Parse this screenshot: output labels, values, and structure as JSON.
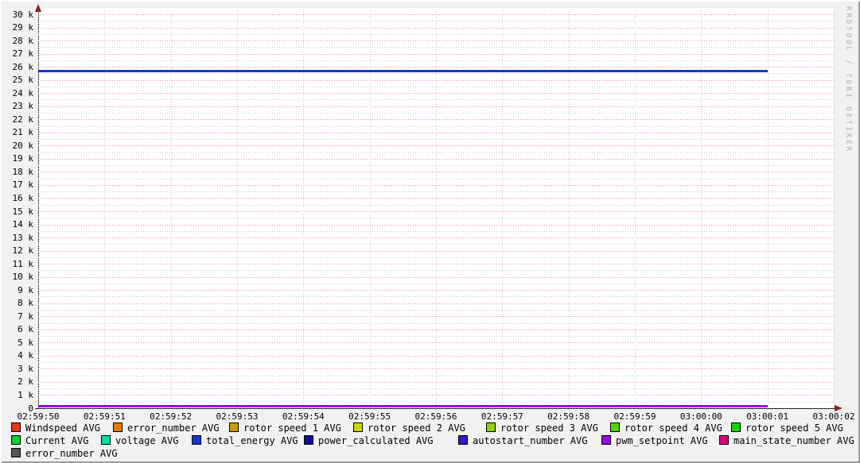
{
  "watermark": "RRDTOOL / TOBI OETIKER",
  "chart_data": {
    "type": "line",
    "title": "",
    "xlabel": "",
    "ylabel": "",
    "ylim": [
      0,
      30000
    ],
    "y_major_step": 1000,
    "y_minor_step": 500,
    "grid": true,
    "y_tick_labels": [
      "0",
      "1 k",
      "2 k",
      "3 k",
      "4 k",
      "5 k",
      "6 k",
      "7 k",
      "8 k",
      "9 k",
      "10 k",
      "11 k",
      "12 k",
      "13 k",
      "14 k",
      "15 k",
      "16 k",
      "17 k",
      "18 k",
      "19 k",
      "20 k",
      "21 k",
      "22 k",
      "23 k",
      "24 k",
      "25 k",
      "26 k",
      "27 k",
      "28 k",
      "29 k",
      "30 k"
    ],
    "x_tick_labels": [
      "02:59:50",
      "02:59:51",
      "02:59:52",
      "02:59:53",
      "02:59:54",
      "02:59:55",
      "02:59:56",
      "02:59:57",
      "02:59:58",
      "02:59:59",
      "03:00:00",
      "03:00:01",
      "03:00:02"
    ],
    "visible_lines": [
      {
        "name": "total_energy AVG",
        "color": "#1038d8",
        "value": 25700,
        "x_start": "02:59:50",
        "x_end": "03:00:01"
      },
      {
        "name": "pwm_setpoint AVG",
        "color": "#a002e0",
        "value": 150,
        "x_start": "02:59:50",
        "x_end": "03:00:01"
      }
    ],
    "legend_position": "bottom",
    "legend_rows": [
      [
        {
          "label": "Windspeed AVG",
          "color": "#e33b0e"
        },
        {
          "label": "error_number AVG",
          "color": "#e07c04"
        },
        {
          "label": "rotor speed 1 AVG",
          "color": "#cc9a00"
        },
        {
          "label": "rotor speed 2 AVG",
          "color": "#ccd300"
        },
        {
          "label": "rotor speed 3 AVG",
          "color": "#92d300"
        },
        {
          "label": "rotor speed 4 AVG",
          "color": "#55d400"
        },
        {
          "label": "rotor speed 5 AVG",
          "color": "#17d300"
        }
      ],
      [
        {
          "label": "Current AVG",
          "color": "#00d42e"
        },
        {
          "label": "voltage AVG",
          "color": "#00dca6"
        },
        {
          "label": "total_energy AVG",
          "color": "#1038d8"
        },
        {
          "label": "power_calculated AVG",
          "color": "#101096"
        },
        {
          "label": "autostart_number AVG",
          "color": "#3a14cc"
        },
        {
          "label": "pwm_setpoint AVG",
          "color": "#a203dd"
        },
        {
          "label": "main_state_number AVG",
          "color": "#d60080"
        }
      ],
      [
        {
          "label": "error_number AVG",
          "color": "#555555"
        }
      ]
    ]
  }
}
